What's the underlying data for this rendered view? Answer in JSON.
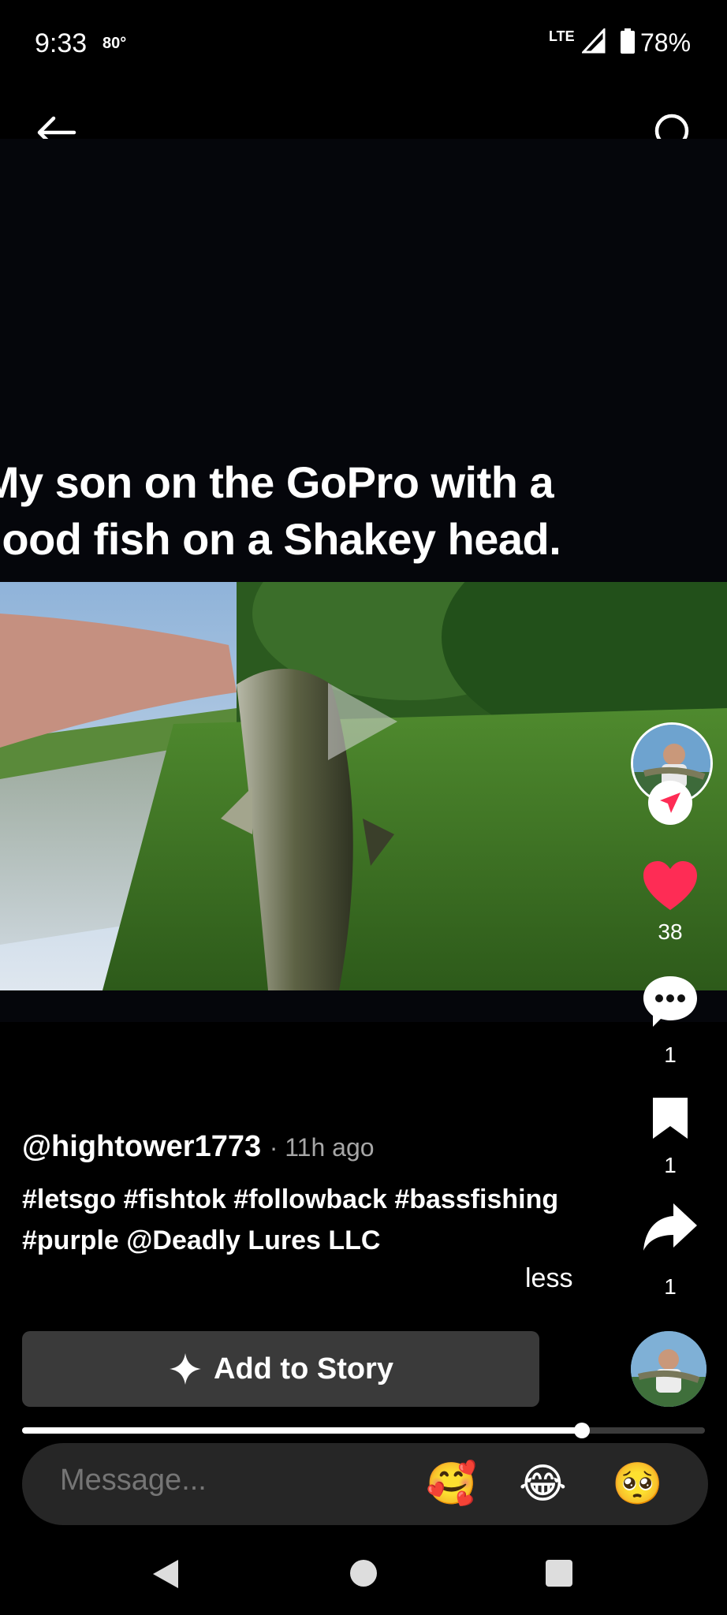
{
  "status_bar": {
    "time": "9:33",
    "temperature": "80°",
    "network": "LTE",
    "battery": "78%"
  },
  "top_bar": {
    "back_icon": "arrow-left-icon",
    "search_icon": "search-icon"
  },
  "video": {
    "overlay_caption": "My son on the GoPro with a good fish on a Shakey head.",
    "play_icon": "play-icon"
  },
  "actions": {
    "like_count": "38",
    "comment_count": "1",
    "bookmark_count": "1",
    "share_count": "1",
    "like_color": "#fe2c55"
  },
  "post": {
    "username": "@hightower1773",
    "time_ago": "11h ago",
    "caption": "#letsgo #fishtok #followback #bassfishing #purple @Deadly Lures LLC",
    "less_label": "less"
  },
  "add_story": {
    "label": "Add to Story"
  },
  "playback": {
    "progress": 0.82
  },
  "message": {
    "placeholder": "Message...",
    "emojis": [
      "🥰",
      "😂",
      "🥺"
    ]
  },
  "nav": {
    "back": "nav-back-icon",
    "home": "nav-home-icon",
    "recents": "nav-recents-icon"
  }
}
